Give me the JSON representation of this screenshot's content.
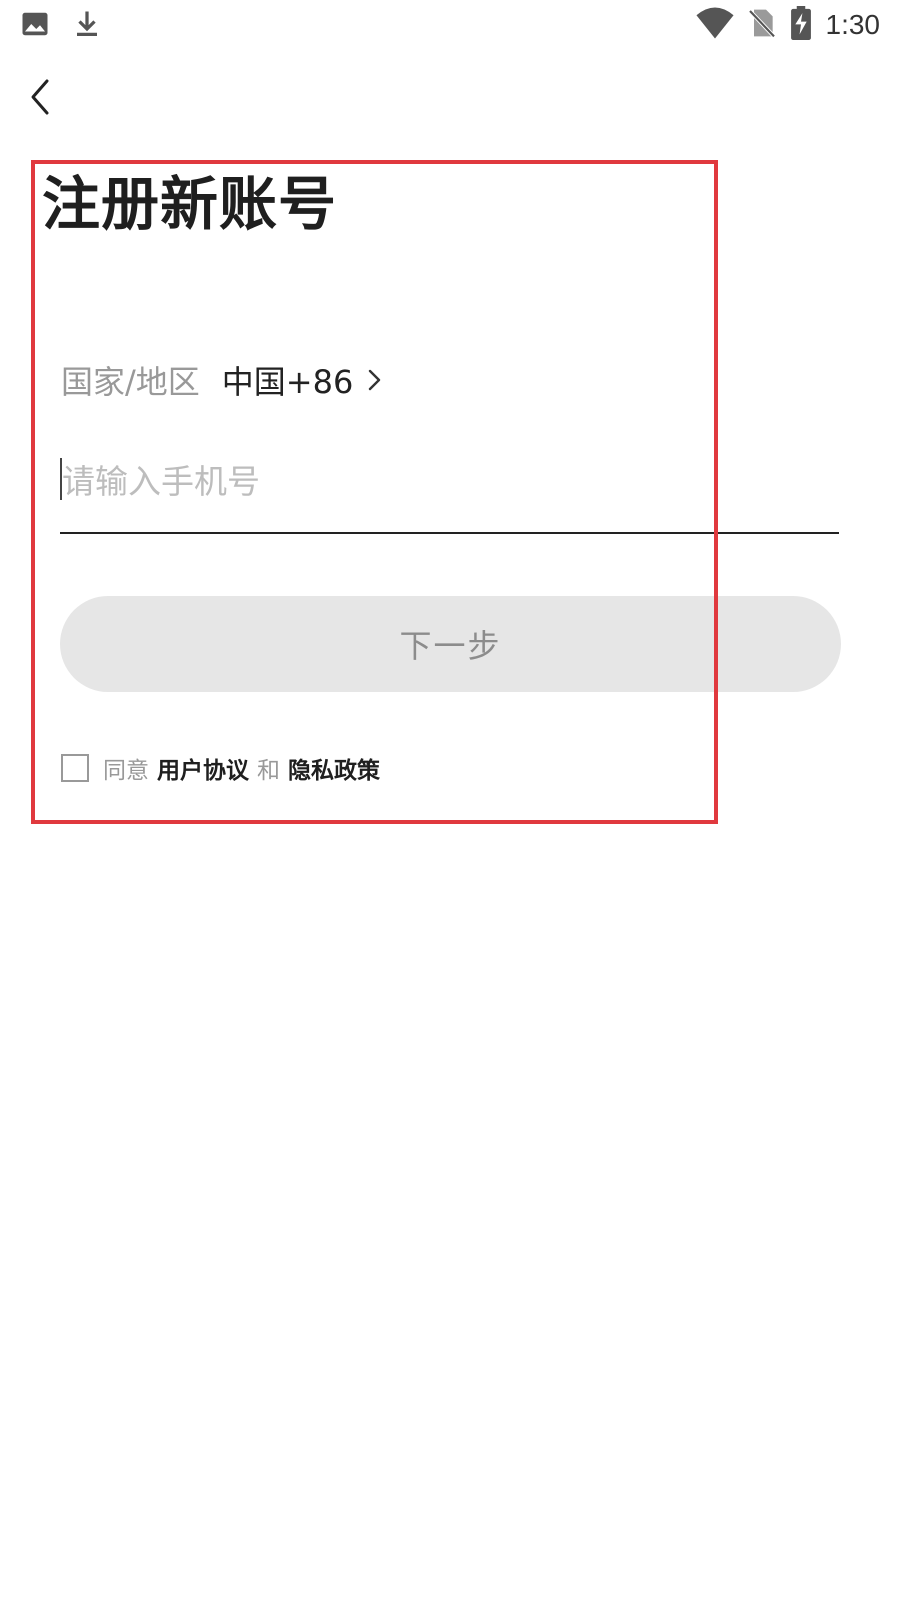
{
  "status_bar": {
    "time": "1:30",
    "left_icons": [
      "image-icon",
      "download-icon"
    ],
    "right_icons": [
      "wifi-icon",
      "no-sim-icon",
      "battery-charging-icon"
    ]
  },
  "page": {
    "title": "注册新账号"
  },
  "region": {
    "label": "国家/地区",
    "value": "中国+86"
  },
  "phone": {
    "value": "",
    "placeholder": "请输入手机号"
  },
  "next_button": {
    "label": "下一步"
  },
  "agreement": {
    "prefix": "同意",
    "user_agreement": "用户协议",
    "conjunction": "和",
    "privacy_policy": "隐私政策"
  },
  "colors": {
    "highlight": "#e0393e",
    "button_bg": "#e6e6e6",
    "button_text": "#8c8c8c"
  }
}
